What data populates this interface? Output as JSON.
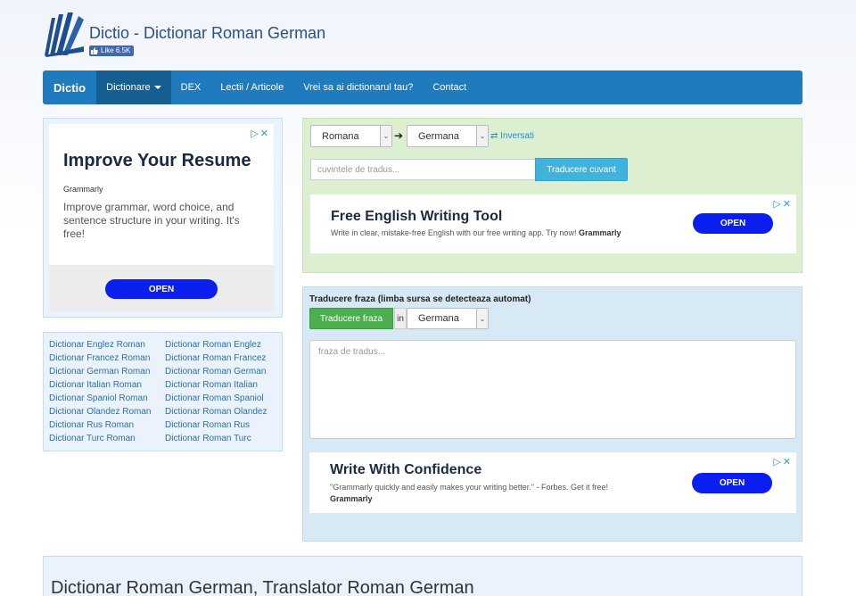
{
  "header": {
    "site_title": "Dictio - Dictionar Roman German",
    "like_label": "Like 6.5K"
  },
  "navbar": {
    "brand": "Dictio",
    "items": [
      {
        "label": "Dictionare"
      },
      {
        "label": "DEX"
      },
      {
        "label": "Lectii / Articole"
      },
      {
        "label": "Vrei sa ai dictionarul tau?"
      },
      {
        "label": "Contact"
      }
    ]
  },
  "left_ad": {
    "title": "Improve Your Resume",
    "brand": "Grammarly",
    "description": "Improve grammar, word choice, and sentence structure in your writing. It's free!",
    "button": "OPEN"
  },
  "dictionary_links": [
    [
      "Dictionar Englez Roman",
      "Dictionar Roman Englez"
    ],
    [
      "Dictionar Francez Roman",
      "Dictionar Roman Francez"
    ],
    [
      "Dictionar German Roman",
      "Dictionar Roman German"
    ],
    [
      "Dictionar Italian Roman",
      "Dictionar Roman Italian"
    ],
    [
      "Dictionar Spaniol Roman",
      "Dictionar Roman Spaniol"
    ],
    [
      "Dictionar Olandez Roman",
      "Dictionar Roman Olandez"
    ],
    [
      "Dictionar Rus Roman",
      "Dictionar Roman Rus"
    ],
    [
      "Dictionar Turc Roman",
      "Dictionar Roman Turc"
    ]
  ],
  "word_translate": {
    "source_lang": "Romana",
    "target_lang": "Germana",
    "swap_label": "Inversati",
    "input_placeholder": "cuvintele de tradus...",
    "button": "Traducere cuvant"
  },
  "ad_banner_1": {
    "title": "Free English Writing Tool",
    "description": "Write in clear, mistake-free English with our free writing app. Try now!",
    "brand": "Grammarly",
    "button": "OPEN"
  },
  "phrase_translate": {
    "heading": "Traducere fraza (limba sursa se detecteaza automat)",
    "button": "Traducere fraza",
    "in_label": "in",
    "target_lang": "Germana",
    "placeholder": "fraza de tradus..."
  },
  "ad_banner_2": {
    "title": "Write With Confidence",
    "description": "\"Grammarly quickly and easily makes your writing better.\" - Forbes. Get it free!",
    "brand": "Grammarly",
    "button": "OPEN"
  },
  "bottom": {
    "title": "Dictionar Roman German, Translator Roman German"
  },
  "colors": {
    "navbar": "#1f7bbd",
    "word_panel": "#dcefd0",
    "phrase_panel": "#d6e9f5",
    "open_button": "#0b1ef0",
    "green_button": "#4cae4c",
    "blue_button": "#3fb2dd"
  }
}
